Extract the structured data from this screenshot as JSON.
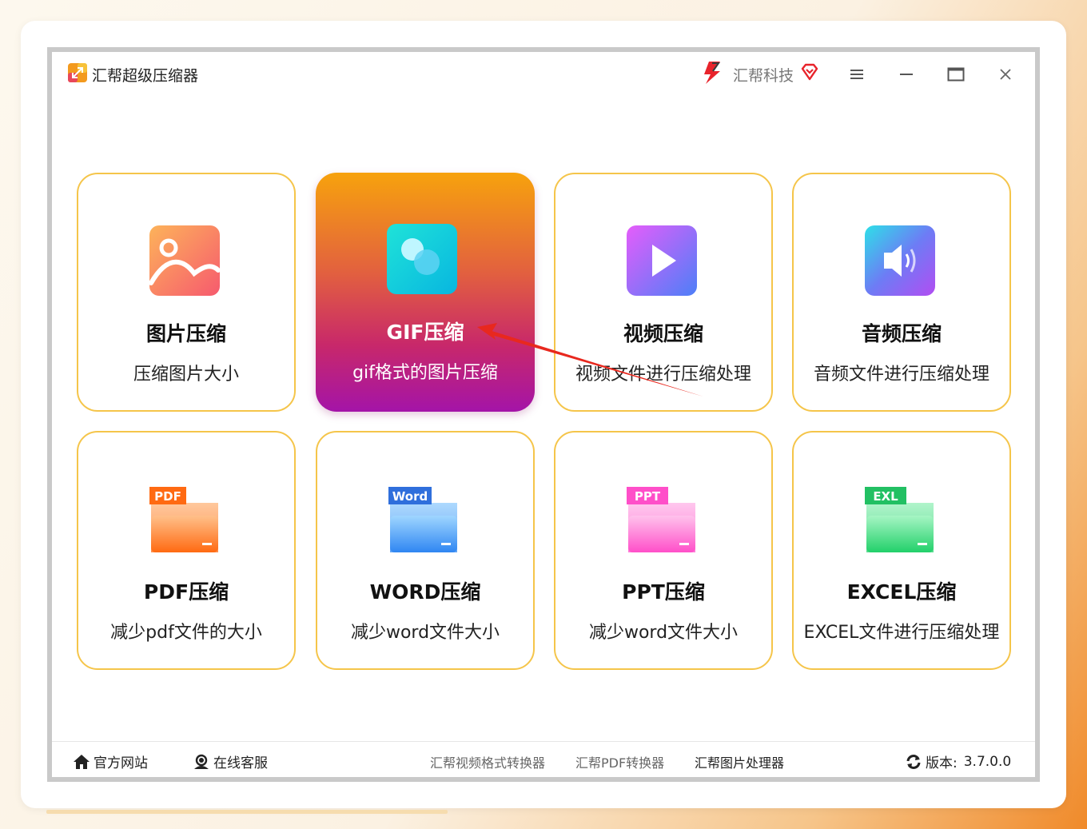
{
  "window": {
    "title": "汇帮超级压缩器",
    "brand": "汇帮科技"
  },
  "tiles": [
    {
      "title": "图片压缩",
      "desc": "压缩图片大小",
      "icon": "image-icon",
      "active": false
    },
    {
      "title": "GIF压缩",
      "desc": "gif格式的图片压缩",
      "icon": "gif-icon",
      "active": true
    },
    {
      "title": "视频压缩",
      "desc": "视频文件进行压缩处理",
      "icon": "video-play-icon",
      "active": false
    },
    {
      "title": "音频压缩",
      "desc": "音频文件进行压缩处理",
      "icon": "audio-speaker-icon",
      "active": false
    },
    {
      "title": "PDF压缩",
      "desc": "减少pdf文件的大小",
      "icon": "pdf-folder-icon",
      "badge": "PDF",
      "active": false
    },
    {
      "title": "WORD压缩",
      "desc": "减少word文件大小",
      "icon": "word-folder-icon",
      "badge": "Word",
      "active": false
    },
    {
      "title": "PPT压缩",
      "desc": "减少word文件大小",
      "icon": "ppt-folder-icon",
      "badge": "PPT",
      "active": false
    },
    {
      "title": "EXCEL压缩",
      "desc": "EXCEL文件进行压缩处理",
      "icon": "excel-folder-icon",
      "badge": "EXL",
      "active": false
    }
  ],
  "footer": {
    "website": "官方网站",
    "support": "在线客服",
    "links": [
      "汇帮视频格式转换器",
      "汇帮PDF转换器",
      "汇帮图片处理器"
    ],
    "version_label": "版本:",
    "version": "3.7.0.0"
  },
  "colors": {
    "tile_border": "#f5c54a",
    "active_top": "#f7a20d",
    "active_bottom": "#a414a8",
    "annotation_arrow": "#e8281e"
  }
}
